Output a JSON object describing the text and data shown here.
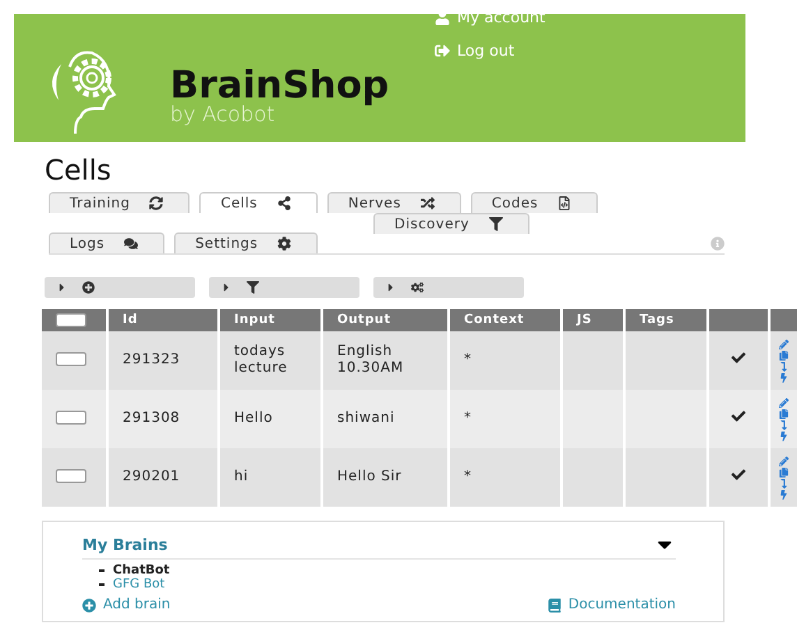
{
  "header": {
    "account_links": [
      {
        "label": "My account",
        "kind": "account"
      },
      {
        "label": "Log out",
        "kind": "logout"
      }
    ],
    "brand": {
      "name": "BrainShop",
      "tagline": "by Acobot"
    }
  },
  "page_title": "Cells",
  "tab_rows": [
    [
      {
        "label": "Training",
        "selected": false
      },
      {
        "label": "Cells",
        "selected": true
      },
      {
        "label": "Nerves",
        "selected": false
      },
      {
        "label": "Codes",
        "selected": false
      }
    ],
    [
      {
        "label": "Discovery",
        "selected": false
      }
    ],
    [
      {
        "label": "Logs",
        "selected": false
      },
      {
        "label": "Settings",
        "selected": false
      }
    ]
  ],
  "table": {
    "columns": [
      "Id",
      "Input",
      "Output",
      "Context",
      "JS",
      "Tags"
    ],
    "header_checkbox": {
      "checked": false
    },
    "rows": [
      {
        "checked": false,
        "id": "291323",
        "input": "todays lecture",
        "output": "English 10.30AM",
        "context": "*"
      },
      {
        "checked": false,
        "id": "291308",
        "input": "Hello",
        "output": "shiwani",
        "context": "*"
      },
      {
        "checked": false,
        "id": "290201",
        "input": "hi",
        "output": "Hello Sir",
        "context": "*"
      }
    ]
  },
  "my_brains": {
    "title": "My Brains",
    "items": [
      {
        "label": "ChatBot",
        "selected": true
      },
      {
        "label": "GFG Bot",
        "selected": false
      }
    ],
    "add_link": "Add brain",
    "docs_link": "Documentation"
  }
}
